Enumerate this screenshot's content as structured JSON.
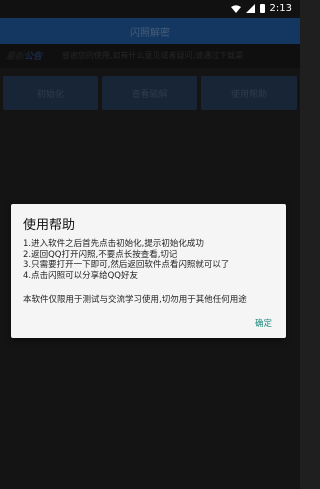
{
  "status_bar": {
    "time": "2:13"
  },
  "app_bar": {
    "title": "闪照解密"
  },
  "notice": {
    "badge_part1": "最新",
    "badge_part2": "公告",
    "text": "感谢您的使用,如有什么意见或者疑问,请通过下载渠"
  },
  "buttons": [
    {
      "label": "初始化"
    },
    {
      "label": "查看破解"
    },
    {
      "label": "使用帮助"
    }
  ],
  "dialog": {
    "title": "使用帮助",
    "lines": [
      "1.进入软件之后首先点击初始化,提示初始化成功",
      "2.返回QQ打开闪照,不要点长按查看,切记",
      "3.只需要打开一下即可,然后返回软件点看闪照就可以了",
      "4.点击闪照可以分享给QQ好友"
    ],
    "note": "本软件仅限用于测试与交流学习使用,切勿用于其他任何用途",
    "ok_label": "确定"
  },
  "colors": {
    "app_bar": "#1e5596",
    "button": "#243a54",
    "dialog_action": "#1b8b7e"
  }
}
